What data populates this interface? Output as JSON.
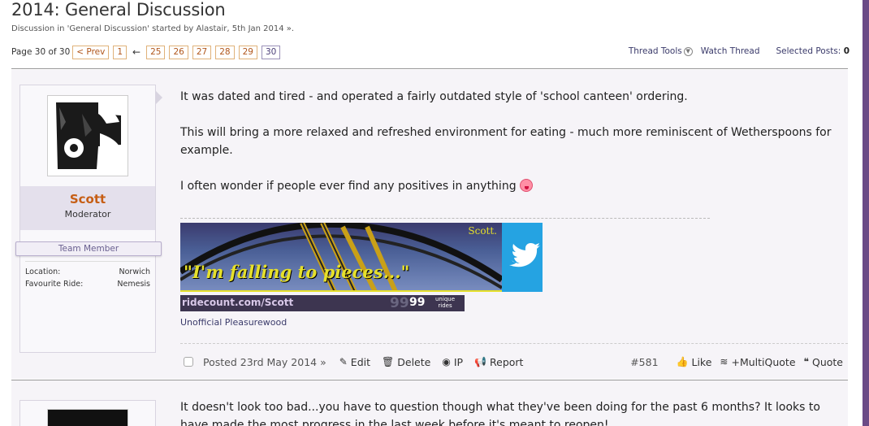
{
  "thread": {
    "title": "2014: General Discussion",
    "byline": "Discussion in 'General Discussion' started by Alastair, 5th Jan 2014 »."
  },
  "pagenav": {
    "label": "Page 30 of 30",
    "prev": "< Prev",
    "first": "1",
    "arrow": "←",
    "pages": [
      "25",
      "26",
      "27",
      "28",
      "29",
      "30"
    ]
  },
  "tools": {
    "thread_tools": "Thread Tools",
    "watch": "Watch Thread",
    "selected_label": "Selected Posts:",
    "selected_count": "0"
  },
  "post1": {
    "user": {
      "name": "Scott",
      "role": "Moderator",
      "team": "Team Member",
      "location_label": "Location:",
      "location": "Norwich",
      "ride_label": "Favourite Ride:",
      "ride": "Nemesis"
    },
    "paragraphs": [
      "It was dated and tired - and operated a fairly outdated style of 'school canteen' ordering.",
      "This will bring a more relaxed and refreshed environment for eating - much more reminiscent of Wetherspoons for example.",
      "I often wonder if people ever find any positives in anything"
    ],
    "signature": {
      "banner_quote": "\"I'm falling to pieces...\"",
      "banner_name": "Scott.",
      "ridecount_url": "ridecount.com/Scott",
      "ridecount_ghost": "99",
      "ridecount_num": "99",
      "ridecount_unit1": "unique",
      "ridecount_unit2": "rides",
      "sig_text": "Unofficial Pleasurewood"
    },
    "actions": {
      "posted": "Posted 23rd May 2014 »",
      "edit": "Edit",
      "delete": "Delete",
      "ip": "IP",
      "report": "Report",
      "post_num": "#581",
      "like": "Like",
      "multiquote": "+MultiQuote",
      "quote": "Quote"
    }
  },
  "post2": {
    "text": "It doesn't look too bad...you have to question though what they've been doing for the past 6 months? It looks to have made the most progress in the last week before it's meant to reopen!"
  },
  "colors": {
    "accent": "#6b4a86",
    "username": "#c65e14",
    "twitter": "#25a3e2"
  }
}
